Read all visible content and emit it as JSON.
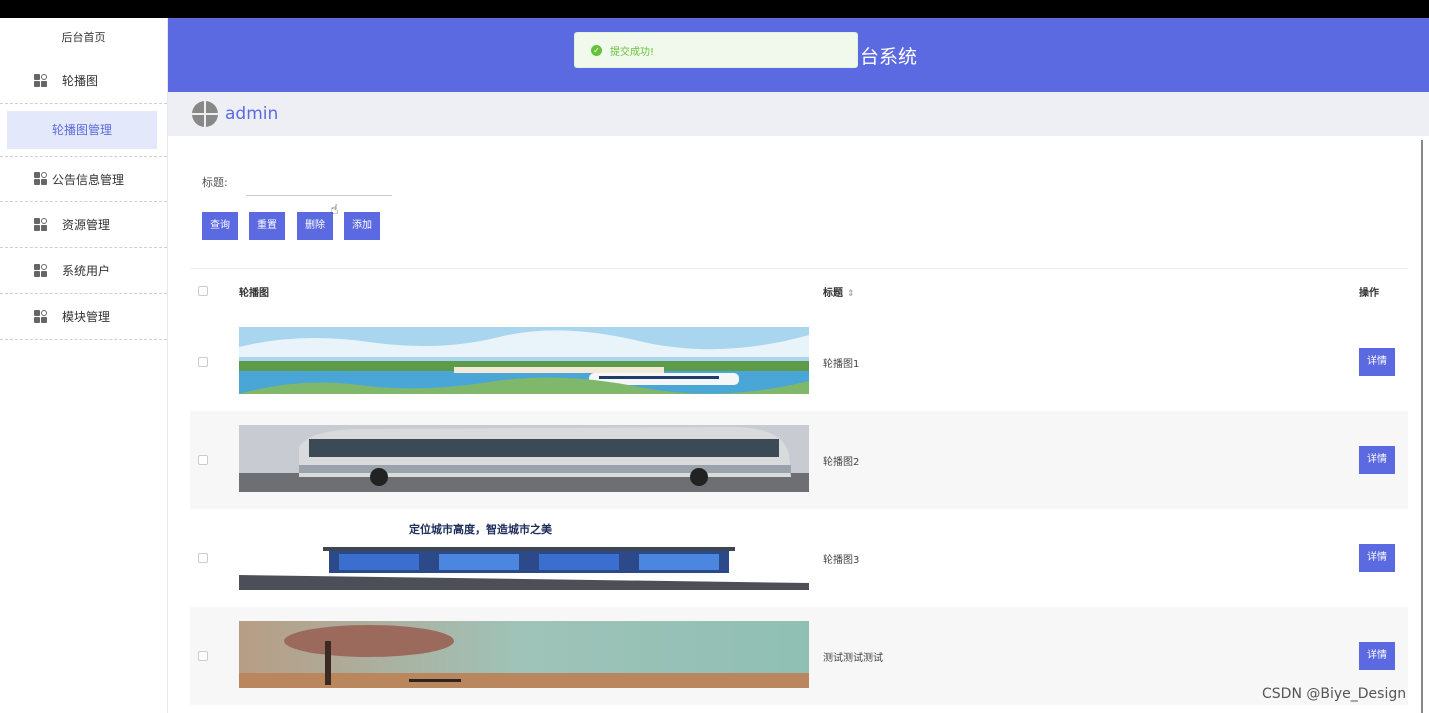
{
  "sidebar": {
    "home": "后台首页",
    "items": [
      {
        "label": "轮播图",
        "sub": "轮播图管理"
      },
      {
        "label": "公告信息管理"
      },
      {
        "label": "资源管理"
      },
      {
        "label": "系统用户"
      },
      {
        "label": "模块管理"
      }
    ]
  },
  "header": {
    "title": "台系统"
  },
  "toast": {
    "message": "提交成功!"
  },
  "user": {
    "name": "admin"
  },
  "search": {
    "label": "标题:",
    "value": "",
    "placeholder": ""
  },
  "buttons": {
    "query": "查询",
    "reset": "重置",
    "delete": "删除",
    "add": "添加"
  },
  "table": {
    "headers": {
      "image": "轮播图",
      "title": "标题",
      "action": "操作"
    },
    "rows": [
      {
        "title": "轮播图1",
        "action": "详情",
        "image": "scenic-lake-train"
      },
      {
        "title": "轮播图2",
        "action": "详情",
        "image": "city-bus"
      },
      {
        "title": "轮播图3",
        "action": "详情",
        "image": "bus-shelter-ad",
        "image_caption": "定位城市高度，智造城市之美"
      },
      {
        "title": "测试测试测试",
        "action": "详情",
        "image": "tree-bench-landscape"
      }
    ]
  },
  "watermark": "CSDN @Biye_Design",
  "colors": {
    "primary": "#5b6ae0",
    "success": "#67c23a",
    "active_bg": "#e4e8fb"
  },
  "icons": {
    "menu": "grid-icon",
    "sort": "sort-icon",
    "toast": "check-circle-icon",
    "cursor": "hand-cursor-icon"
  }
}
